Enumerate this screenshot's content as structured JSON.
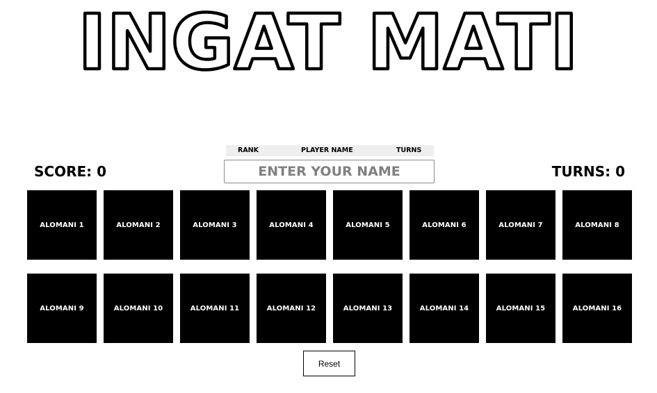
{
  "game": {
    "title": "INGAT MATI"
  },
  "leaderboard": {
    "rank_header": "Rank",
    "player_name_header": "Player Name",
    "turns_header": "Turns"
  },
  "name_input": {
    "placeholder": "Enter your name",
    "value": ""
  },
  "stats": {
    "score_label": "Score: 0",
    "turns_label": "Turns: 0",
    "score": 0,
    "turns": 0
  },
  "cards": [
    {
      "label": "Alomani 1"
    },
    {
      "label": "Alomani 2"
    },
    {
      "label": "Alomani 3"
    },
    {
      "label": "Alomani 4"
    },
    {
      "label": "Alomani 5"
    },
    {
      "label": "Alomani 6"
    },
    {
      "label": "Alomani 7"
    },
    {
      "label": "Alomani 8"
    },
    {
      "label": "Alomani 9"
    },
    {
      "label": "Alomani 10"
    },
    {
      "label": "Alomani 11"
    },
    {
      "label": "Alomani 12"
    },
    {
      "label": "Alomani 13"
    },
    {
      "label": "Alomani 14"
    },
    {
      "label": "Alomani 15"
    },
    {
      "label": "Alomani 16"
    }
  ],
  "controls": {
    "reset_label": "Reset"
  },
  "colors": {
    "card_background": "#000000",
    "card_text": "#ffffff",
    "leaderboard_background": "#eeeeee",
    "placeholder_text": "#808080"
  }
}
